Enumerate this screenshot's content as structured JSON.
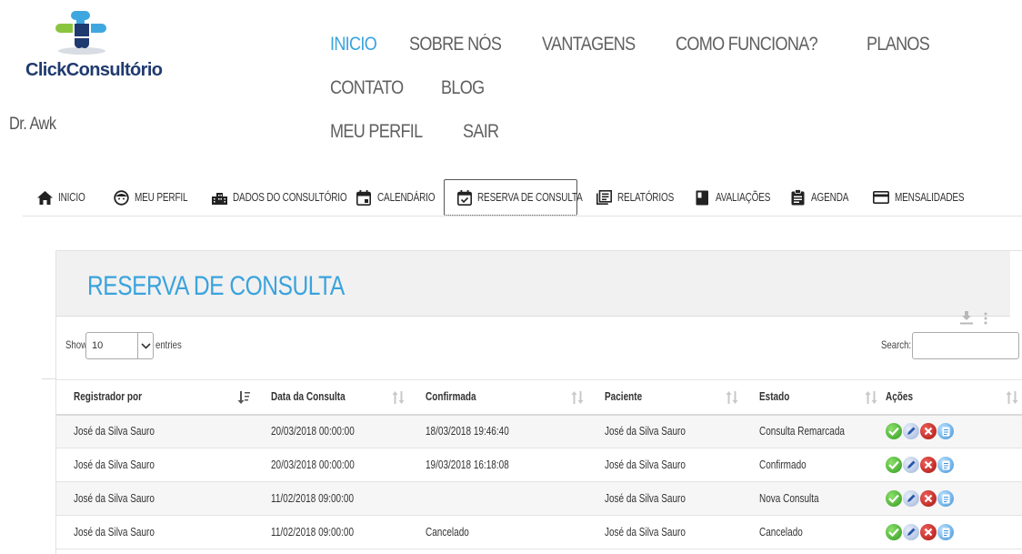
{
  "brand": {
    "name": "ClickConsultório",
    "logo_icon": "puzzle-cross-logo"
  },
  "main_nav": [
    {
      "label": "INICIO",
      "active": true
    },
    {
      "label": "SOBRE NÓS"
    },
    {
      "label": "VANTAGENS"
    },
    {
      "label": "COMO FUNCIONA?"
    },
    {
      "label": "PLANOS"
    },
    {
      "label": "CONTATO"
    },
    {
      "label": "BLOG"
    },
    {
      "label": "MEU PERFIL"
    },
    {
      "label": "SAIR"
    }
  ],
  "user": {
    "name": "Dr. Awk"
  },
  "tabs": [
    {
      "label": "INICIO",
      "icon": "home-icon"
    },
    {
      "label": "MEU PERFIL",
      "icon": "face-icon"
    },
    {
      "label": "DADOS DO CONSULTÓRIO",
      "icon": "building-icon"
    },
    {
      "label": "CALENDÁRIO",
      "icon": "calendar-icon"
    },
    {
      "label": "RESERVA DE CONSULTA",
      "icon": "calendar-check-icon",
      "active": true
    },
    {
      "label": "RELATÓRIOS",
      "icon": "reports-icon"
    },
    {
      "label": "AVALIAÇÕES",
      "icon": "book-icon"
    },
    {
      "label": "AGENDA",
      "icon": "clipboard-icon"
    },
    {
      "label": "MENSALIDADES",
      "icon": "credit-card-icon"
    }
  ],
  "panel": {
    "title": "RESERVA DE CONSULTA",
    "tools": {
      "download_icon": "download-icon",
      "menu_icon": "more-vertical-icon"
    }
  },
  "table_controls": {
    "show_label": "Show",
    "length_value": "10",
    "entries_label": "entries",
    "search_label": "Search:",
    "search_value": ""
  },
  "table": {
    "columns": [
      "Registrador por",
      "Data da Consulta",
      "Confirmada",
      "Paciente",
      "Estado",
      "Ações"
    ],
    "rows": [
      {
        "registrador": "José da Silva Sauro",
        "data": "20/03/2018 00:00:00",
        "confirmada": "18/03/2018 19:46:40",
        "paciente": "José da Silva Sauro",
        "estado": "Consulta Remarcada"
      },
      {
        "registrador": "José da Silva Sauro",
        "data": "20/03/2018 00:00:00",
        "confirmada": "19/03/2018 16:18:08",
        "paciente": "José da Silva Sauro",
        "estado": "Confirmado"
      },
      {
        "registrador": "José da Silva Sauro",
        "data": "11/02/2018 09:00:00",
        "confirmada": "",
        "paciente": "José da Silva Sauro",
        "estado": "Nova Consulta"
      },
      {
        "registrador": "José da Silva Sauro",
        "data": "11/02/2018 09:00:00",
        "confirmada": "Cancelado",
        "paciente": "José da Silva Sauro",
        "estado": "Cancelado"
      }
    ],
    "action_icons": [
      "confirm-icon",
      "edit-icon",
      "cancel-icon",
      "notes-icon"
    ]
  },
  "colors": {
    "accent": "#3aa3dd",
    "brand_dark": "#1f3a6e",
    "nav_text": "#606060"
  }
}
